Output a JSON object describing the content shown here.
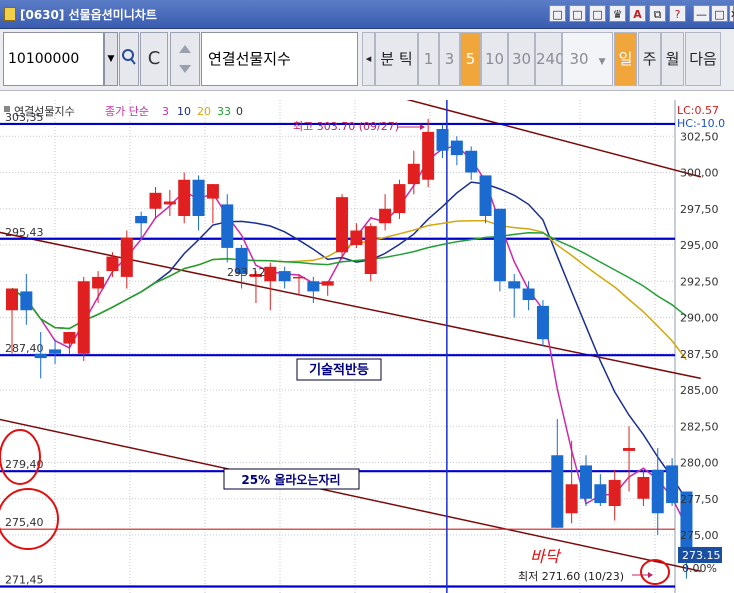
{
  "window": {
    "title": "[0630] 선물옵션미니차트",
    "buttons": [
      "□",
      "□",
      "□",
      "♛",
      "A",
      "⧉",
      "?",
      "—",
      "□",
      "✕"
    ]
  },
  "toolbar": {
    "code_value": "10100000",
    "name_value": "연결선물지수",
    "left_arrow": "◂",
    "tick_label": "분 틱",
    "periods": [
      "1",
      "3",
      "5",
      "10",
      "30",
      "240"
    ],
    "active_period": "5",
    "count_value": "30",
    "day_label": "일",
    "week_label": "주",
    "month_label": "월",
    "next_label": "다음"
  },
  "chart_data": {
    "type": "candlestick",
    "instrument": "연결선물지수",
    "legend": {
      "series_name": "연결선물지수",
      "ma_label": "종가 단순",
      "ma_periods": [
        "3",
        "10",
        "20",
        "33",
        "0"
      ],
      "ma_colors": [
        "#cc2aa8",
        "#1a2f8f",
        "#d4a80c",
        "#22a036",
        "#333333"
      ]
    },
    "right_labels": [
      "LC:0.57",
      "HC:-10.0"
    ],
    "y_ticks": [
      302.5,
      300.0,
      297.5,
      295.0,
      292.5,
      290.0,
      287.5,
      285.0,
      282.5,
      280.0,
      277.5,
      275.0
    ],
    "y_tick_labels": [
      "302,50",
      "300,00",
      "297,50",
      "295,00",
      "292,50",
      "290,00",
      "287,50",
      "285,00",
      "282,50",
      "280,00",
      "277,50",
      "275,00"
    ],
    "ylim": [
      271.0,
      305.0
    ],
    "current_price": "273.15",
    "current_pct": "0.00%",
    "candles": [
      {
        "o": 290.5,
        "h": 292.0,
        "l": 287.5,
        "c": 292.0
      },
      {
        "o": 291.8,
        "h": 293.0,
        "l": 289.5,
        "c": 290.5
      },
      {
        "o": 287.5,
        "h": 289.0,
        "l": 285.8,
        "c": 287.2
      },
      {
        "o": 287.8,
        "h": 288.5,
        "l": 286.8,
        "c": 287.5
      },
      {
        "o": 288.2,
        "h": 289.0,
        "l": 287.5,
        "c": 289.0
      },
      {
        "o": 287.5,
        "h": 292.8,
        "l": 287.0,
        "c": 292.5
      },
      {
        "o": 292.0,
        "h": 293.2,
        "l": 291.0,
        "c": 292.8
      },
      {
        "o": 293.2,
        "h": 294.5,
        "l": 292.8,
        "c": 294.2
      },
      {
        "o": 292.8,
        "h": 296.0,
        "l": 292.0,
        "c": 295.5
      },
      {
        "o": 297.0,
        "h": 297.3,
        "l": 295.5,
        "c": 296.5
      },
      {
        "o": 297.5,
        "h": 299.0,
        "l": 296.8,
        "c": 298.6
      },
      {
        "o": 297.8,
        "h": 298.8,
        "l": 297.0,
        "c": 298.0
      },
      {
        "o": 297.0,
        "h": 300.0,
        "l": 296.5,
        "c": 299.5
      },
      {
        "o": 299.5,
        "h": 299.8,
        "l": 296.0,
        "c": 297.0
      },
      {
        "o": 298.2,
        "h": 299.2,
        "l": 296.5,
        "c": 299.2
      },
      {
        "o": 297.8,
        "h": 298.5,
        "l": 293.8,
        "c": 294.8
      },
      {
        "o": 294.8,
        "h": 295.0,
        "l": 292.0,
        "c": 293.0
      },
      {
        "o": 292.8,
        "h": 293.2,
        "l": 291.0,
        "c": 293.0
      },
      {
        "o": 292.5,
        "h": 293.8,
        "l": 290.5,
        "c": 293.5
      },
      {
        "o": 293.2,
        "h": 293.5,
        "l": 292.0,
        "c": 292.5
      },
      {
        "o": 292.8,
        "h": 293.0,
        "l": 291.5,
        "c": 292.8
      },
      {
        "o": 292.5,
        "h": 292.8,
        "l": 291.0,
        "c": 291.8
      },
      {
        "o": 292.2,
        "h": 292.5,
        "l": 291.5,
        "c": 292.5
      },
      {
        "o": 294.5,
        "h": 298.5,
        "l": 294.0,
        "c": 298.3
      },
      {
        "o": 295.0,
        "h": 296.5,
        "l": 294.8,
        "c": 296.0
      },
      {
        "o": 293.0,
        "h": 296.5,
        "l": 292.5,
        "c": 296.3
      },
      {
        "o": 296.5,
        "h": 298.5,
        "l": 296.0,
        "c": 297.5
      },
      {
        "o": 297.2,
        "h": 299.5,
        "l": 296.8,
        "c": 299.2
      },
      {
        "o": 299.2,
        "h": 301.5,
        "l": 298.5,
        "c": 300.6
      },
      {
        "o": 299.5,
        "h": 303.7,
        "l": 299.0,
        "c": 302.8
      },
      {
        "o": 303.0,
        "h": 303.3,
        "l": 301.0,
        "c": 301.5
      },
      {
        "o": 302.2,
        "h": 302.5,
        "l": 300.5,
        "c": 301.2
      },
      {
        "o": 301.5,
        "h": 301.8,
        "l": 299.5,
        "c": 300.0
      },
      {
        "o": 299.8,
        "h": 299.8,
        "l": 296.5,
        "c": 297.0
      },
      {
        "o": 297.5,
        "h": 297.5,
        "l": 291.8,
        "c": 292.5
      },
      {
        "o": 292.5,
        "h": 293.0,
        "l": 290.0,
        "c": 292.0
      },
      {
        "o": 292.0,
        "h": 292.5,
        "l": 290.5,
        "c": 291.2
      },
      {
        "o": 290.8,
        "h": 291.2,
        "l": 288.0,
        "c": 288.5
      },
      {
        "o": 280.5,
        "h": 283.0,
        "l": 275.5,
        "c": 275.5
      },
      {
        "o": 276.5,
        "h": 281.5,
        "l": 275.8,
        "c": 278.5
      },
      {
        "o": 279.8,
        "h": 280.5,
        "l": 277.0,
        "c": 277.5
      },
      {
        "o": 278.5,
        "h": 279.2,
        "l": 277.0,
        "c": 277.2
      },
      {
        "o": 277.0,
        "h": 279.5,
        "l": 276.0,
        "c": 278.8
      },
      {
        "o": 280.8,
        "h": 282.5,
        "l": 278.0,
        "c": 281.0
      },
      {
        "o": 277.5,
        "h": 279.5,
        "l": 277.0,
        "c": 279.0
      },
      {
        "o": 279.5,
        "h": 281.0,
        "l": 275.0,
        "c": 276.5
      },
      {
        "o": 279.8,
        "h": 280.3,
        "l": 277.0,
        "c": 277.2
      },
      {
        "o": 278.0,
        "h": 278.0,
        "l": 272.0,
        "c": 273.15
      }
    ],
    "horizontal_lines": [
      {
        "y": 303.35,
        "color": "#0000cc",
        "label": "303,35"
      },
      {
        "y": 295.43,
        "color": "#0000cc",
        "label": "295,43"
      },
      {
        "y": 287.4,
        "color": "#0000cc",
        "label": "287,40"
      },
      {
        "y": 279.4,
        "color": "#0000cc",
        "label": "279,40"
      },
      {
        "y": 275.4,
        "color": "#d02020",
        "label": "275,40"
      },
      {
        "y": 271.45,
        "color": "#0000cc",
        "label": "271,45"
      }
    ],
    "trend_lines": [
      {
        "x1": -1,
        "y1": 295.9,
        "x2": 48,
        "y2": 285.8
      },
      {
        "x1": 20,
        "y1": 307.0,
        "x2": 48,
        "y2": 299.7
      },
      {
        "x1": -1,
        "y1": 283.0,
        "x2": 48,
        "y2": 272.5
      }
    ],
    "vertical_line_index": 31,
    "annotations": {
      "high_label": "최고 303.70 (09/27)",
      "low_label": "최저 271.60 (10/23)",
      "mid_label": "293.12",
      "box1": "기술적반등",
      "box2": "25% 올라오는자리",
      "handwritten": "바닥"
    }
  }
}
